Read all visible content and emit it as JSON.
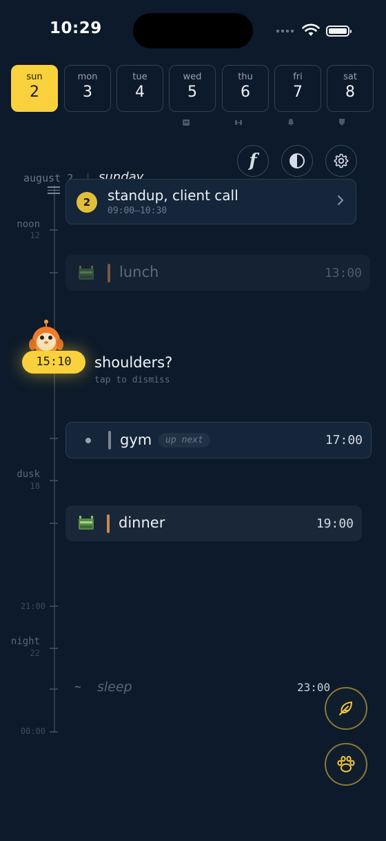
{
  "status": {
    "time": "10:29"
  },
  "days": [
    {
      "name": "sun",
      "num": "2",
      "active": true
    },
    {
      "name": "mon",
      "num": "3"
    },
    {
      "name": "tue",
      "num": "4"
    },
    {
      "name": "wed",
      "num": "5"
    },
    {
      "name": "thu",
      "num": "6"
    },
    {
      "name": "fri",
      "num": "7"
    },
    {
      "name": "sat",
      "num": "8"
    }
  ],
  "toolbar": {
    "f_label": "f"
  },
  "date_header": {
    "date": "august 2",
    "separator": "|",
    "weekday": "sunday"
  },
  "summary": {
    "count": "2",
    "title": "standup, client call",
    "time": "09:00–10:30"
  },
  "axis": {
    "noon": "noon",
    "noon_sub": "12",
    "dusk": "dusk",
    "dusk_sub": "18",
    "t2100": "21:00",
    "night": "night",
    "night_sub": "22",
    "t0000": "00:00"
  },
  "events": {
    "lunch": {
      "title": "lunch",
      "time": "13:00"
    },
    "gym": {
      "title": "gym",
      "badge": "up next",
      "time": "17:00"
    },
    "dinner": {
      "title": "dinner",
      "time": "19:00"
    },
    "sleep": {
      "prefix": "~",
      "title": "sleep",
      "time": "23:00"
    }
  },
  "now": {
    "time": "15:10",
    "prompt": "shoulders?",
    "hint": "tap to dismiss"
  },
  "colors": {
    "accent": "#f8d13d",
    "background": "#0d1a2b",
    "meal_bar": "#c98a4e"
  }
}
